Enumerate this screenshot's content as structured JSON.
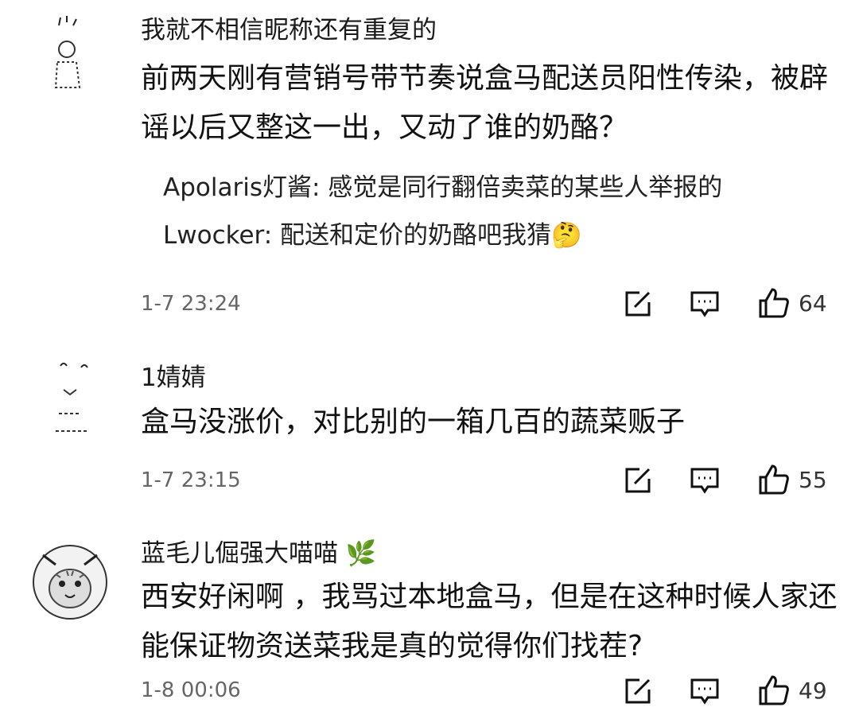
{
  "comments": [
    {
      "username": "我就不相信昵称还有重复的",
      "body": "前两天刚有营销号带节奏说盒马配送员阳性传染，被辟谣以后又整这一出，又动了谁的奶酪？",
      "replies": [
        {
          "author": "Apolaris灯酱",
          "text": "Apolaris灯酱: 感觉是同行翻倍卖菜的某些人举报的"
        },
        {
          "author": "Lwocker",
          "text": "Lwocker: 配送和定价的奶酪吧我猜🤔"
        }
      ],
      "time": "1-7 23:24",
      "likes": "64"
    },
    {
      "username": "1婧婧",
      "body": "盒马没涨价，对比别的一箱几百的蔬菜贩子",
      "replies": [],
      "time": "1-7 23:15",
      "likes": "55"
    },
    {
      "username": "蓝毛儿倔强大喵喵 🌿",
      "body": "西安好闲啊 ，我骂过本地盒马，但是在这种时候人家还能保证物资送菜我是真的觉得你们找茬?",
      "replies": [],
      "time": "1-8 00:06",
      "likes": "49"
    }
  ],
  "icons": {
    "edit": "share-edit-icon",
    "reply": "comment-icon",
    "like": "thumbs-up-icon"
  }
}
